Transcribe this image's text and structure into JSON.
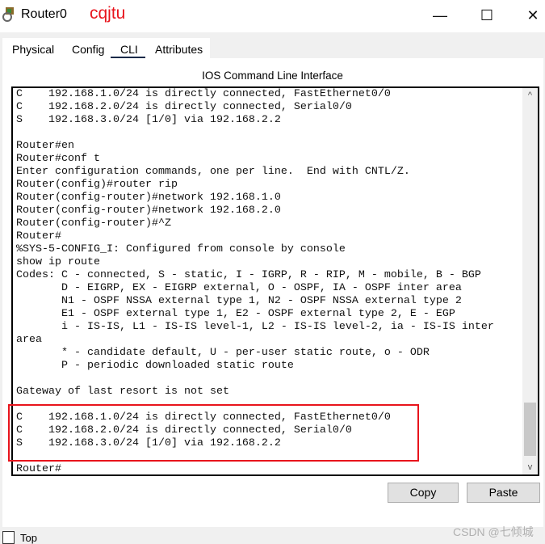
{
  "window": {
    "title": "Router0",
    "brand": "cqjtu",
    "minimize": "—",
    "maximize": "☐",
    "close": "✕"
  },
  "tabs": [
    {
      "label": "Physical"
    },
    {
      "label": "Config"
    },
    {
      "label": "CLI",
      "active": true
    },
    {
      "label": "Attributes"
    }
  ],
  "cli": {
    "heading": "IOS Command Line Interface",
    "lines": [
      "C    192.168.1.0/24 is directly connected, FastEthernet0/0",
      "C    192.168.2.0/24 is directly connected, Serial0/0",
      "S    192.168.3.0/24 [1/0] via 192.168.2.2",
      "",
      "Router#en",
      "Router#conf t",
      "Enter configuration commands, one per line.  End with CNTL/Z.",
      "Router(config)#router rip",
      "Router(config-router)#network 192.168.1.0",
      "Router(config-router)#network 192.168.2.0",
      "Router(config-router)#^Z",
      "Router#",
      "%SYS-5-CONFIG_I: Configured from console by console",
      "show ip route",
      "Codes: C - connected, S - static, I - IGRP, R - RIP, M - mobile, B - BGP",
      "       D - EIGRP, EX - EIGRP external, O - OSPF, IA - OSPF inter area",
      "       N1 - OSPF NSSA external type 1, N2 - OSPF NSSA external type 2",
      "       E1 - OSPF external type 1, E2 - OSPF external type 2, E - EGP",
      "       i - IS-IS, L1 - IS-IS level-1, L2 - IS-IS level-2, ia - IS-IS inter",
      "area",
      "       * - candidate default, U - per-user static route, o - ODR",
      "       P - periodic downloaded static route",
      "",
      "Gateway of last resort is not set",
      "",
      "C    192.168.1.0/24 is directly connected, FastEthernet0/0",
      "C    192.168.2.0/24 is directly connected, Serial0/0",
      "S    192.168.3.0/24 [1/0] via 192.168.2.2",
      "",
      "Router#"
    ],
    "scroll_up": "^",
    "scroll_down": "v"
  },
  "buttons": {
    "copy": "Copy",
    "paste": "Paste"
  },
  "top_checkbox": {
    "label": "Top",
    "checked": false
  },
  "watermark": "CSDN @七倾城",
  "colors": {
    "highlight": "#e8141c",
    "tab_underline": "#152a48"
  }
}
